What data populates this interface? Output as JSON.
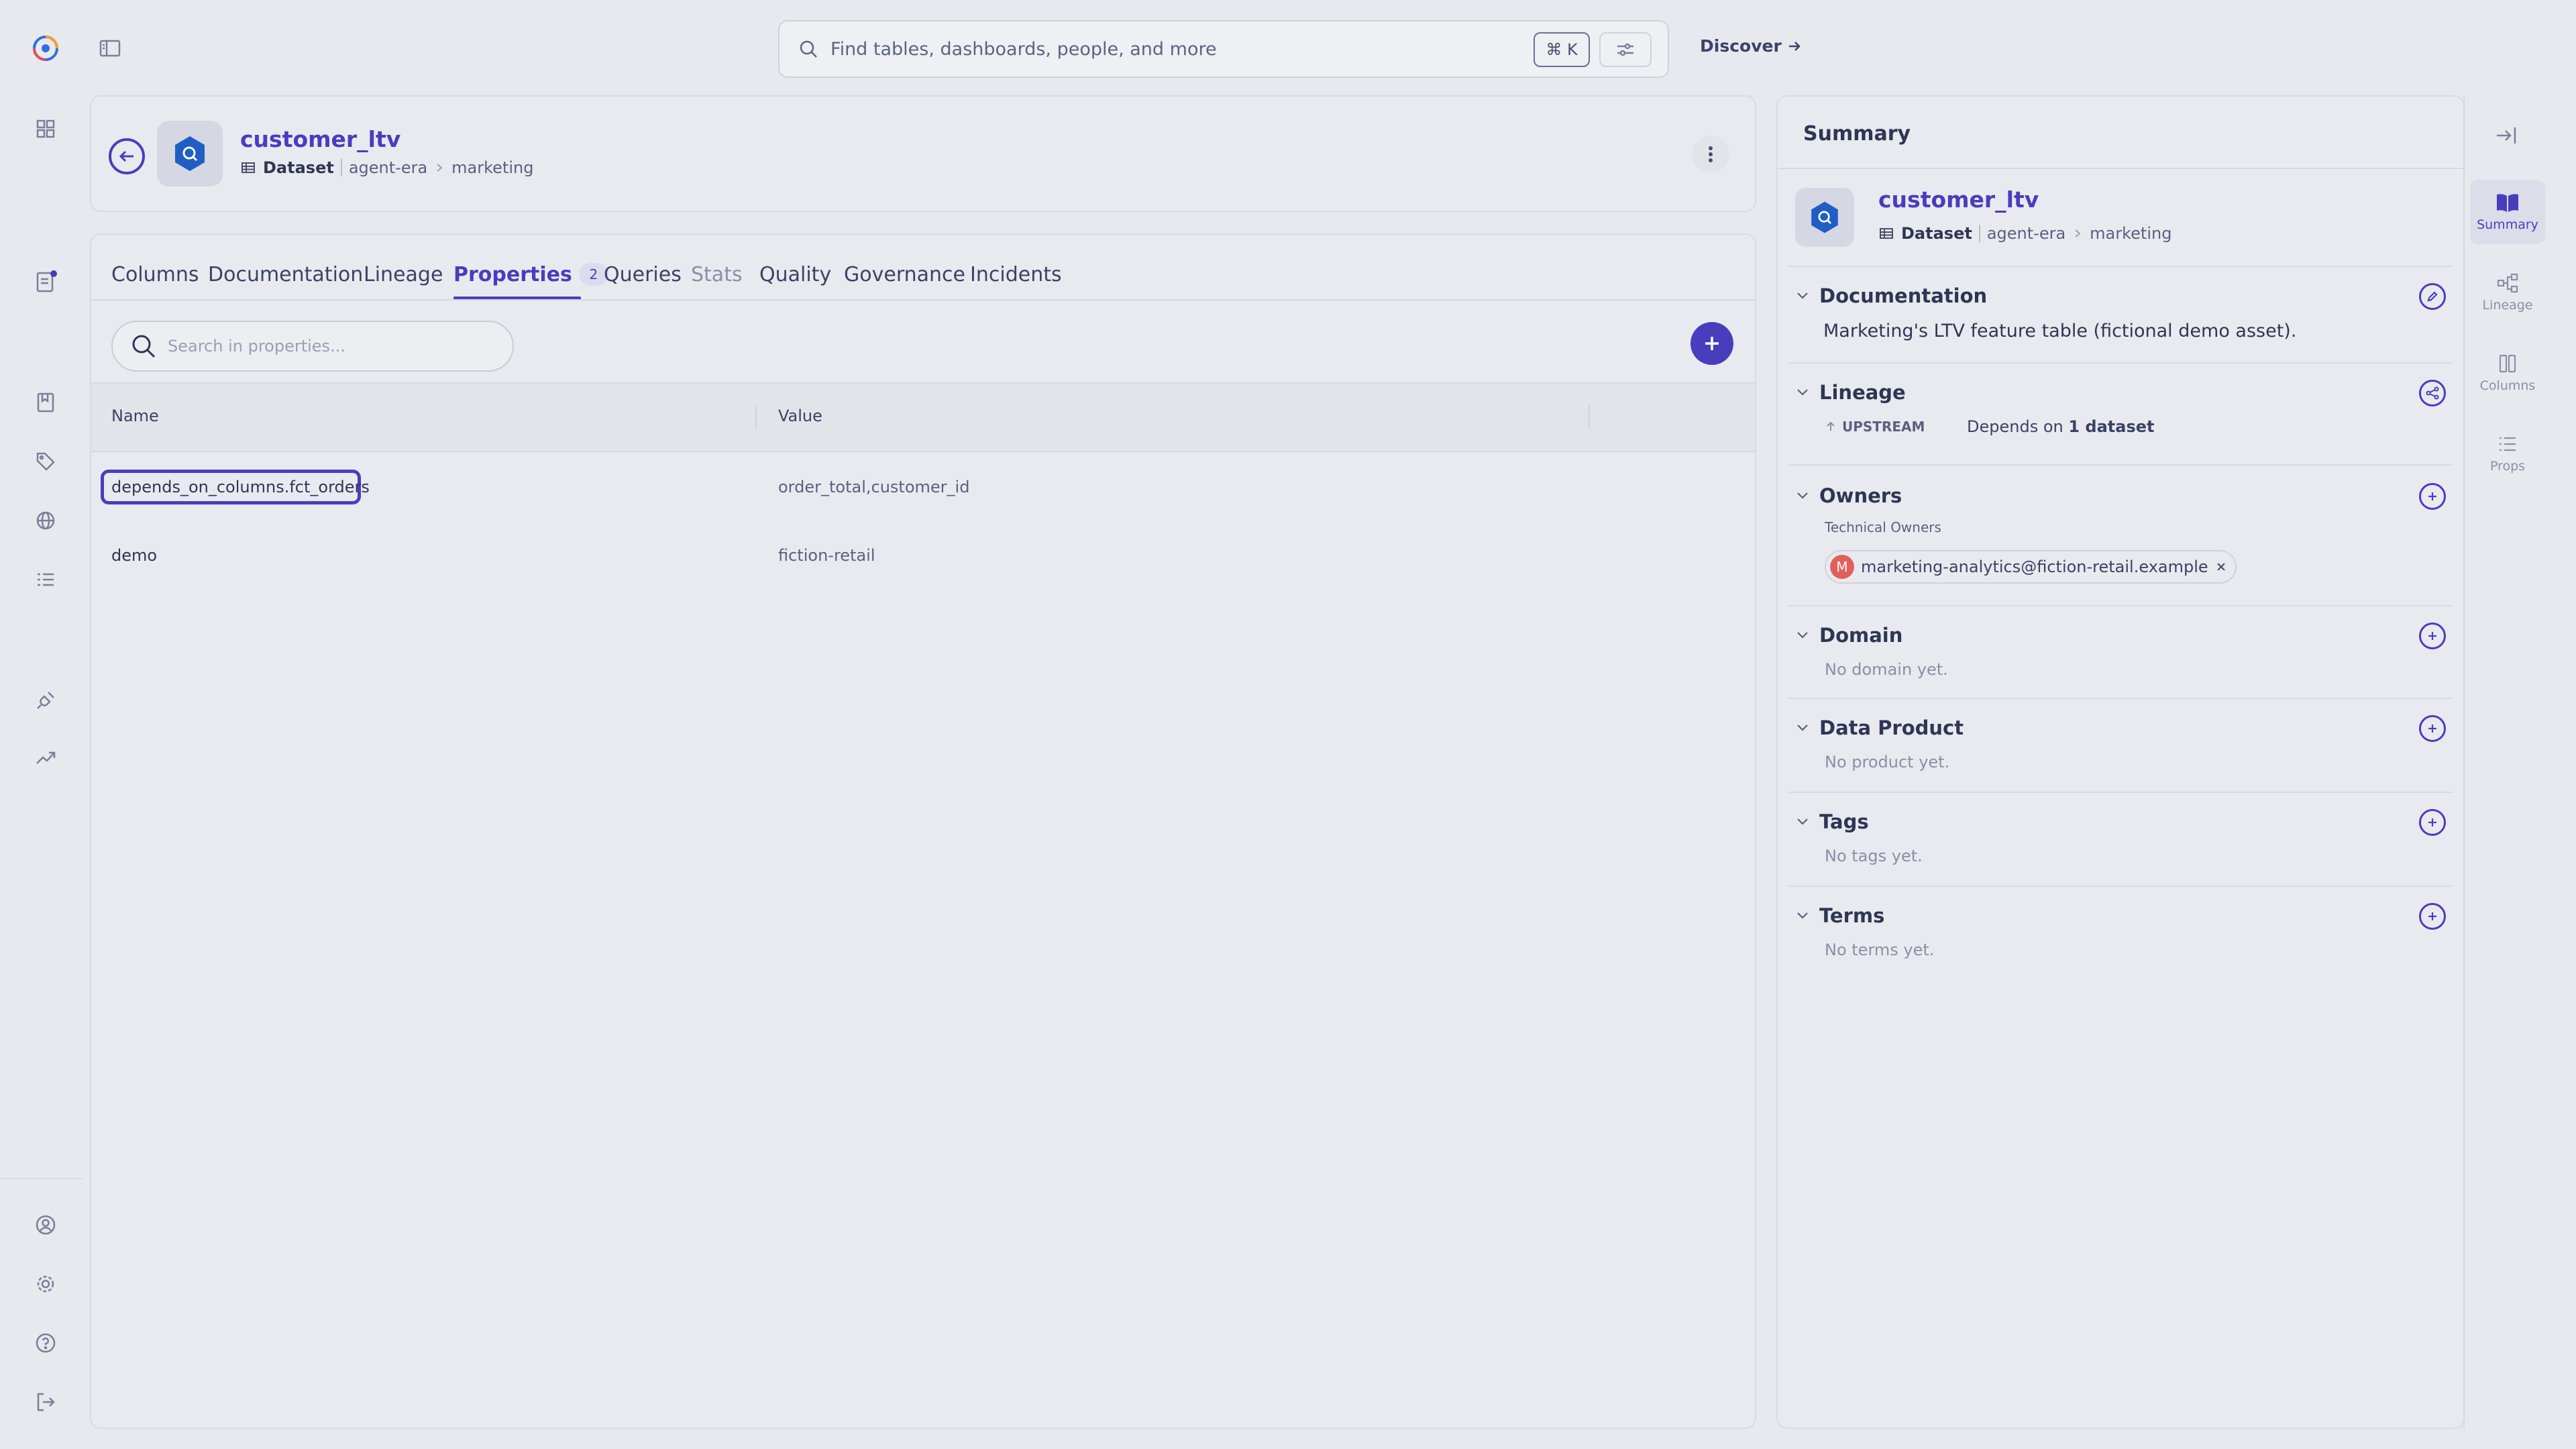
{
  "search": {
    "placeholder": "Find tables, dashboards, people, and more",
    "shortcut": "⌘ K"
  },
  "topbar": {
    "discover_label": "Discover"
  },
  "entity": {
    "name": "customer_ltv",
    "type": "Dataset",
    "platform": "agent-era",
    "container": "marketing"
  },
  "tabs": [
    {
      "label": "Columns"
    },
    {
      "label": "Documentation"
    },
    {
      "label": "Lineage"
    },
    {
      "label": "Properties",
      "count": "2"
    },
    {
      "label": "Queries"
    },
    {
      "label": "Stats"
    },
    {
      "label": "Quality"
    },
    {
      "label": "Governance"
    },
    {
      "label": "Incidents"
    }
  ],
  "properties": {
    "search_placeholder": "Search in properties...",
    "headers": {
      "name": "Name",
      "value": "Value"
    },
    "rows": [
      {
        "name": "depends_on_columns.fct_orders",
        "value": "order_total,customer_id"
      },
      {
        "name": "demo",
        "value": "fiction-retail"
      }
    ]
  },
  "summary": {
    "title": "Summary",
    "documentation": {
      "label": "Documentation",
      "text": "Marketing's LTV feature table (fictional demo asset)."
    },
    "lineage": {
      "label": "Lineage",
      "direction": "UPSTREAM",
      "depends_prefix": "Depends on",
      "depends_count": "1 dataset"
    },
    "owners": {
      "label": "Owners",
      "sublabel": "Technical Owners",
      "owner_initial": "M",
      "owner_email": "marketing-analytics@fiction-retail.example"
    },
    "domain": {
      "label": "Domain",
      "empty": "No domain yet."
    },
    "data_product": {
      "label": "Data Product",
      "empty": "No product yet."
    },
    "tags": {
      "label": "Tags",
      "empty": "No tags yet."
    },
    "terms": {
      "label": "Terms",
      "empty": "No terms yet."
    }
  },
  "side_nav": [
    {
      "label": "Summary",
      "icon": "book-icon"
    },
    {
      "label": "Lineage",
      "icon": "lineage-icon"
    },
    {
      "label": "Columns",
      "icon": "columns-icon"
    },
    {
      "label": "Props",
      "icon": "list-icon"
    }
  ],
  "colors": {
    "accent": "#4a3dbd",
    "background": "#e8e9ee",
    "avatar": "#e0605c",
    "notification_dot": "#4a3dbd"
  }
}
